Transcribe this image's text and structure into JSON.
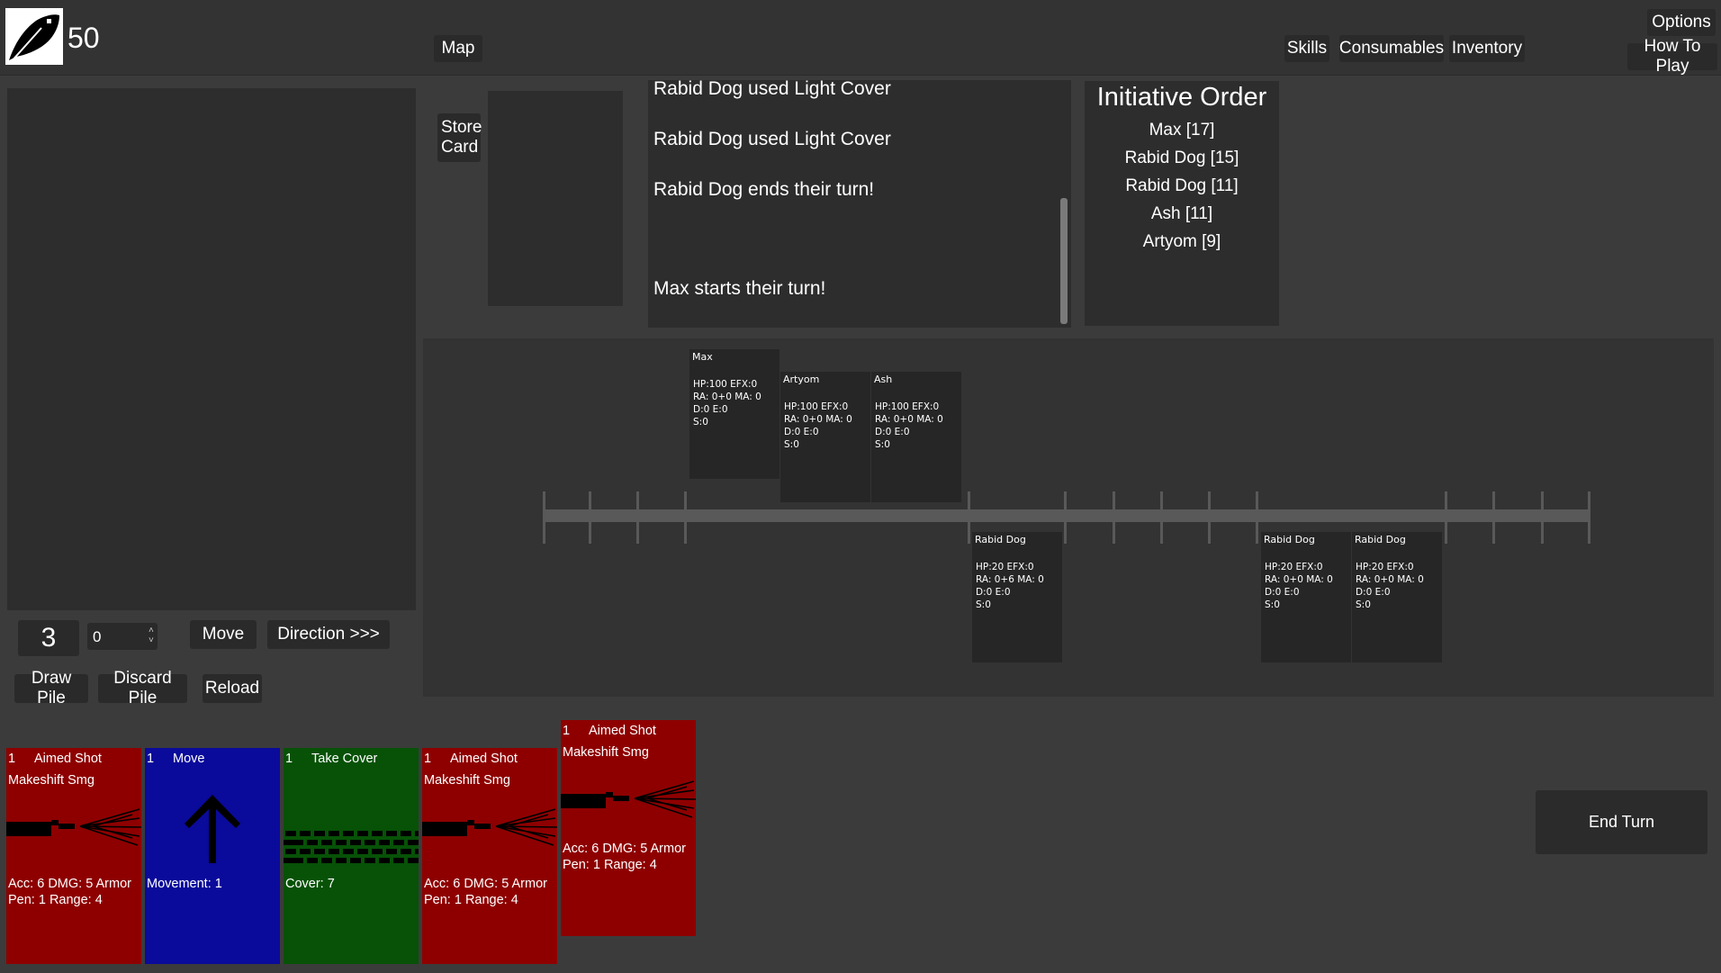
{
  "header": {
    "avatar_icon": "feather-icon",
    "score": "50",
    "map_label": "Map",
    "skills_label": "Skills",
    "consumables_label": "Consumables",
    "inventory_label": "Inventory",
    "options_label": "Options",
    "how_to_play_label": "How To Play"
  },
  "store_card_label": "Store Card",
  "log": [
    "Rabid Dog used Light Cover",
    "Rabid Dog used Light Cover",
    "Rabid Dog ends their turn!",
    "Max starts their turn!"
  ],
  "initiative": {
    "title": "Initiative Order",
    "items": [
      "Max [17]",
      "Rabid Dog [15]",
      "Rabid Dog [11]",
      "Ash [11]",
      "Artyom [9]"
    ]
  },
  "units": [
    {
      "name": "Max",
      "hp": "HP:100 EFX:0",
      "ra": "RA: 0+0 MA: 0",
      "de": "D:0 E:0",
      "s": "S:0"
    },
    {
      "name": "Artyom",
      "hp": "HP:100 EFX:0",
      "ra": "RA: 0+0 MA: 0",
      "de": "D:0 E:0",
      "s": "S:0"
    },
    {
      "name": "Ash",
      "hp": "HP:100 EFX:0",
      "ra": "RA: 0+0 MA: 0",
      "de": "D:0 E:0",
      "s": "S:0"
    },
    {
      "name": "Rabid Dog",
      "hp": "HP:20 EFX:0",
      "ra": "RA: 0+6 MA: 0",
      "de": "D:0 E:0",
      "s": "S:0"
    },
    {
      "name": "Rabid Dog",
      "hp": "HP:20 EFX:0",
      "ra": "RA: 0+0 MA: 0",
      "de": "D:0 E:0",
      "s": "S:0"
    },
    {
      "name": "Rabid Dog",
      "hp": "HP:20 EFX:0",
      "ra": "RA: 0+0 MA: 0",
      "de": "D:0 E:0",
      "s": "S:0"
    }
  ],
  "controls": {
    "energy": "3",
    "spinner_value": "0",
    "move_label": "Move",
    "direction_label": "Direction >>>",
    "draw_pile_label": "Draw Pile",
    "discard_pile_label": "Discard Pile",
    "reload_label": "Reload",
    "end_turn_label": "End Turn"
  },
  "cards": [
    {
      "cost": "1",
      "name": "Aimed Shot",
      "weapon": "Makeshift Smg",
      "stats1": "Acc: 6 DMG: 5 Armor",
      "stats2": "Pen: 1 Range: 4",
      "icon": "smg-icon",
      "color": "#8e0000"
    },
    {
      "cost": "1",
      "name": "Move",
      "weapon": "",
      "stats1": "Movement: 1",
      "stats2": "",
      "icon": "arrow-up-icon",
      "color": "#0a0a9b"
    },
    {
      "cost": "1",
      "name": "Take Cover",
      "weapon": "",
      "stats1": "Cover: 7",
      "stats2": "",
      "icon": "brick-wall-icon",
      "color": "#075207"
    },
    {
      "cost": "1",
      "name": "Aimed Shot",
      "weapon": "Makeshift Smg",
      "stats1": "Acc: 6 DMG: 5 Armor",
      "stats2": "Pen: 1 Range: 4",
      "icon": "smg-icon",
      "color": "#8e0000"
    },
    {
      "cost": "1",
      "name": "Aimed Shot",
      "weapon": "Makeshift Smg",
      "stats1": "Acc: 6 DMG: 5 Armor",
      "stats2": "Pen: 1 Range: 4",
      "icon": "smg-icon",
      "color": "#8e0000"
    }
  ]
}
